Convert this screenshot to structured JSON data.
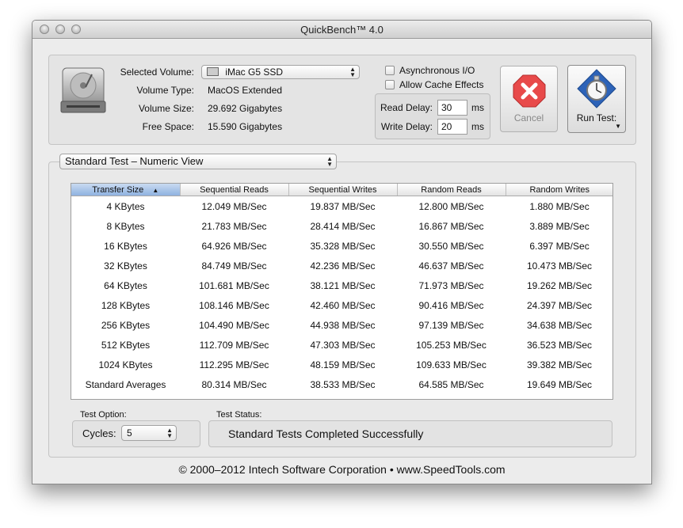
{
  "window": {
    "title": "QuickBench™ 4.0"
  },
  "volume": {
    "selected_label": "Selected Volume:",
    "selected_value": "iMac G5 SSD",
    "type_label": "Volume Type:",
    "type_value": "MacOS Extended",
    "size_label": "Volume Size:",
    "size_value": "29.692 Gigabytes",
    "free_label": "Free Space:",
    "free_value": "15.590 Gigabytes"
  },
  "options": {
    "async_label": "Asynchronous I/O",
    "async_checked": false,
    "cache_label": "Allow Cache Effects",
    "cache_checked": false
  },
  "delays": {
    "read_label": "Read Delay:",
    "read_value": "30",
    "write_label": "Write Delay:",
    "write_value": "20",
    "unit": "ms"
  },
  "buttons": {
    "cancel_label": "Cancel",
    "run_label": "Run Test:"
  },
  "view_popup": "Standard Test – Numeric View",
  "table": {
    "headers": [
      "Transfer Size",
      "Sequential Reads",
      "Sequential Writes",
      "Random Reads",
      "Random Writes"
    ],
    "rows": [
      [
        "4 KBytes",
        "12.049 MB/Sec",
        "19.837 MB/Sec",
        "12.800 MB/Sec",
        "1.880 MB/Sec"
      ],
      [
        "8 KBytes",
        "21.783 MB/Sec",
        "28.414 MB/Sec",
        "16.867 MB/Sec",
        "3.889 MB/Sec"
      ],
      [
        "16 KBytes",
        "64.926 MB/Sec",
        "35.328 MB/Sec",
        "30.550 MB/Sec",
        "6.397 MB/Sec"
      ],
      [
        "32 KBytes",
        "84.749 MB/Sec",
        "42.236 MB/Sec",
        "46.637 MB/Sec",
        "10.473 MB/Sec"
      ],
      [
        "64 KBytes",
        "101.681 MB/Sec",
        "38.121 MB/Sec",
        "71.973 MB/Sec",
        "19.262 MB/Sec"
      ],
      [
        "128 KBytes",
        "108.146 MB/Sec",
        "42.460 MB/Sec",
        "90.416 MB/Sec",
        "24.397 MB/Sec"
      ],
      [
        "256 KBytes",
        "104.490 MB/Sec",
        "44.938 MB/Sec",
        "97.139 MB/Sec",
        "34.638 MB/Sec"
      ],
      [
        "512 KBytes",
        "112.709 MB/Sec",
        "47.303 MB/Sec",
        "105.253 MB/Sec",
        "36.523 MB/Sec"
      ],
      [
        "1024 KBytes",
        "112.295 MB/Sec",
        "48.159 MB/Sec",
        "109.633 MB/Sec",
        "39.382 MB/Sec"
      ],
      [
        "Standard Averages",
        "80.314 MB/Sec",
        "38.533 MB/Sec",
        "64.585 MB/Sec",
        "19.649 MB/Sec"
      ]
    ]
  },
  "test_option": {
    "label": "Test Option:",
    "cycles_label": "Cycles:",
    "cycles_value": "5"
  },
  "status": {
    "label": "Test Status:",
    "text": "Standard Tests Completed Successfully"
  },
  "footer": "© 2000–2012 Intech Software Corporation • www.SpeedTools.com",
  "icons": {
    "volume": "hard-drive-icon",
    "cancel": "cancel-x-icon",
    "run": "stopwatch-icon",
    "sort": "sort-ascending-icon"
  },
  "colors": {
    "cancel_red": "#e84a4a",
    "run_blue": "#2d63b8",
    "sort_header": "#9db9e4"
  }
}
